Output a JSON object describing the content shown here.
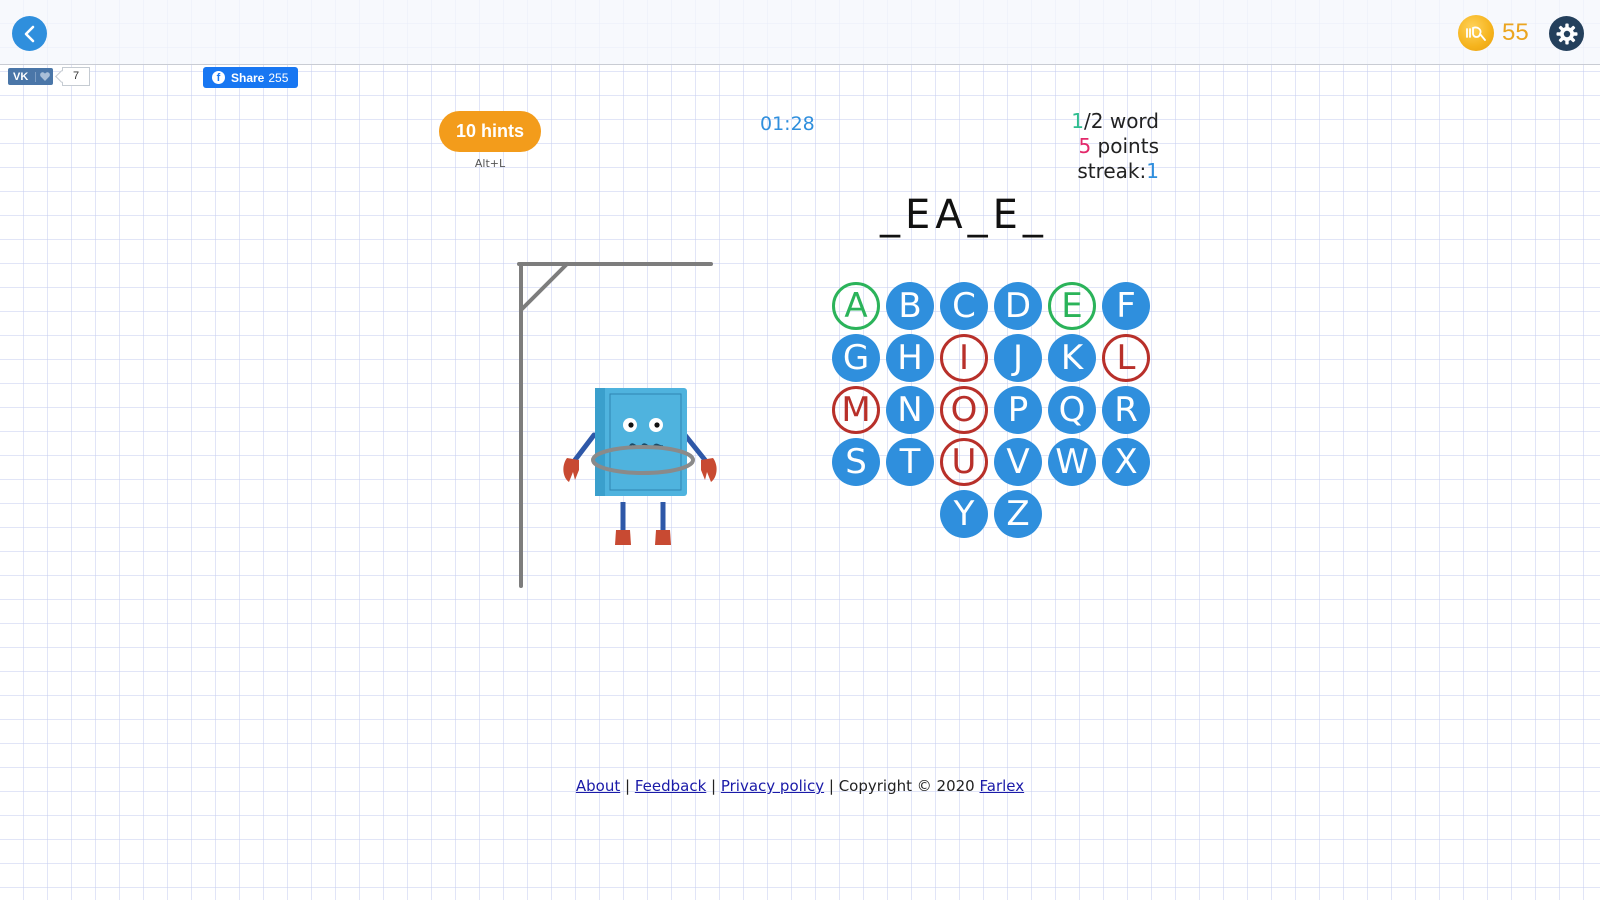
{
  "header": {
    "back_icon": "chevron-left-icon",
    "coin_icon": "coin-icon",
    "coins": "55",
    "settings_icon": "gear-icon"
  },
  "social": {
    "vk_label": "VK",
    "vk_count": "7",
    "fb_label": "Share",
    "fb_count": "255"
  },
  "game": {
    "hints_label": "10 hints",
    "hints_shortcut": "Alt+L",
    "timer": "01:28",
    "word_current": "1",
    "word_total_label": "/2 word",
    "points_value": "5",
    "points_label": " points",
    "streak_label": "streak:",
    "streak_value": "1",
    "masked_word": "_EA_E_",
    "keyboard_rows": [
      [
        {
          "letter": "A",
          "state": "correct"
        },
        {
          "letter": "B",
          "state": "unused"
        },
        {
          "letter": "C",
          "state": "unused"
        },
        {
          "letter": "D",
          "state": "unused"
        },
        {
          "letter": "E",
          "state": "correct"
        },
        {
          "letter": "F",
          "state": "unused"
        }
      ],
      [
        {
          "letter": "G",
          "state": "unused"
        },
        {
          "letter": "H",
          "state": "unused"
        },
        {
          "letter": "I",
          "state": "wrong"
        },
        {
          "letter": "J",
          "state": "unused"
        },
        {
          "letter": "K",
          "state": "unused"
        },
        {
          "letter": "L",
          "state": "wrong"
        }
      ],
      [
        {
          "letter": "M",
          "state": "wrong"
        },
        {
          "letter": "N",
          "state": "unused"
        },
        {
          "letter": "O",
          "state": "wrong"
        },
        {
          "letter": "P",
          "state": "unused"
        },
        {
          "letter": "Q",
          "state": "unused"
        },
        {
          "letter": "R",
          "state": "unused"
        }
      ],
      [
        {
          "letter": "S",
          "state": "unused"
        },
        {
          "letter": "T",
          "state": "unused"
        },
        {
          "letter": "U",
          "state": "wrong"
        },
        {
          "letter": "V",
          "state": "unused"
        },
        {
          "letter": "W",
          "state": "unused"
        },
        {
          "letter": "X",
          "state": "unused"
        }
      ],
      [
        {
          "letter": "Y",
          "state": "unused"
        },
        {
          "letter": "Z",
          "state": "unused"
        }
      ]
    ]
  },
  "footer": {
    "about": "About",
    "feedback": "Feedback",
    "privacy": "Privacy policy",
    "copyright": "Copyright © 2020",
    "company": "Farlex",
    "separator": " | "
  },
  "colors": {
    "accent_blue": "#2f8fdd",
    "correct_green": "#2bb35a",
    "wrong_red": "#b8302a",
    "hints_orange": "#f39c1b",
    "coin_gold": "#eba51f"
  }
}
